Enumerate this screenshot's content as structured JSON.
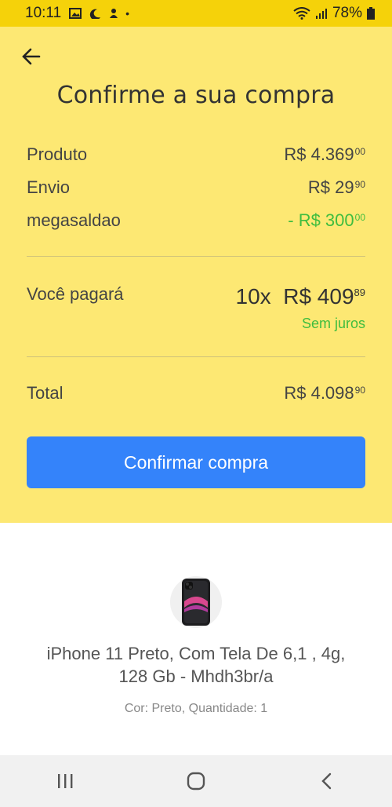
{
  "status_bar": {
    "time": "10:11",
    "battery": "78%"
  },
  "header": {
    "title": "Confirme a sua compra"
  },
  "summary": {
    "produto_label": "Produto",
    "produto_value": "R$ 4.369",
    "produto_cents": "00",
    "envio_label": "Envio",
    "envio_value": "R$ 29",
    "envio_cents": "90",
    "desconto_label": "megasaldao",
    "desconto_value": "- R$ 300",
    "desconto_cents": "00"
  },
  "payment": {
    "label": "Você pagará",
    "installments": "10x",
    "installment_value": "R$ 409",
    "installment_cents": "89",
    "interest": "Sem juros"
  },
  "total": {
    "label": "Total",
    "value": "R$ 4.098",
    "cents": "90"
  },
  "confirm_button": {
    "label": "Confirmar compra"
  },
  "product": {
    "name": "iPhone 11 Preto, Com Tela De 6,1 , 4g, 128 Gb - Mhdh3br/a",
    "details": "Cor: Preto, Quantidade: 1"
  },
  "colors": {
    "top_bg": "#fde873",
    "status_bg": "#f5d20a",
    "button": "#3483fa",
    "green": "#3fbd3f"
  }
}
